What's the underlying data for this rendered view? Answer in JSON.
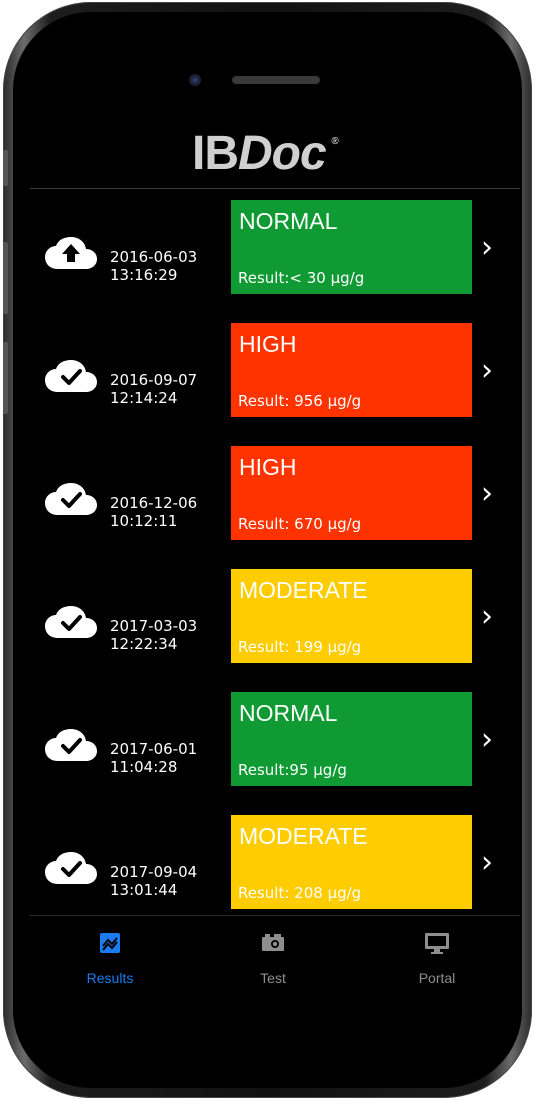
{
  "app": {
    "logo_ib": "IB",
    "logo_doc": "Doc",
    "logo_mark": "®"
  },
  "results": [
    {
      "date": "2016-06-03",
      "time": "13:16:29",
      "status": "NORMAL",
      "result": "Result:< 30 µg/g",
      "color": "#0f9a33",
      "sync_icon": "cloud-upload-icon"
    },
    {
      "date": "2016-09-07",
      "time": "12:14:24",
      "status": "HIGH",
      "result": "Result: 956 µg/g",
      "color": "#ff3300",
      "sync_icon": "cloud-check-icon"
    },
    {
      "date": "2016-12-06",
      "time": "10:12:11",
      "status": "HIGH",
      "result": "Result: 670 µg/g",
      "color": "#ff3300",
      "sync_icon": "cloud-check-icon"
    },
    {
      "date": "2017-03-03",
      "time": "12:22:34",
      "status": "MODERATE",
      "result": "Result: 199 µg/g",
      "color": "#ffcc00",
      "sync_icon": "cloud-check-icon"
    },
    {
      "date": "2017-06-01",
      "time": "11:04:28",
      "status": "NORMAL",
      "result": "Result:95 µg/g",
      "color": "#0f9a33",
      "sync_icon": "cloud-check-icon"
    },
    {
      "date": "2017-09-04",
      "time": "13:01:44",
      "status": "MODERATE",
      "result": "Result: 208 µg/g",
      "color": "#ffcc00",
      "sync_icon": "cloud-check-icon"
    }
  ],
  "tabs": [
    {
      "label": "Results",
      "icon": "chart-icon",
      "active": true,
      "color": "#1a7cf0"
    },
    {
      "label": "Test",
      "icon": "camera-icon",
      "active": false,
      "color": "#8e8e8e"
    },
    {
      "label": "Portal",
      "icon": "monitor-icon",
      "active": false,
      "color": "#8e8e8e"
    }
  ]
}
